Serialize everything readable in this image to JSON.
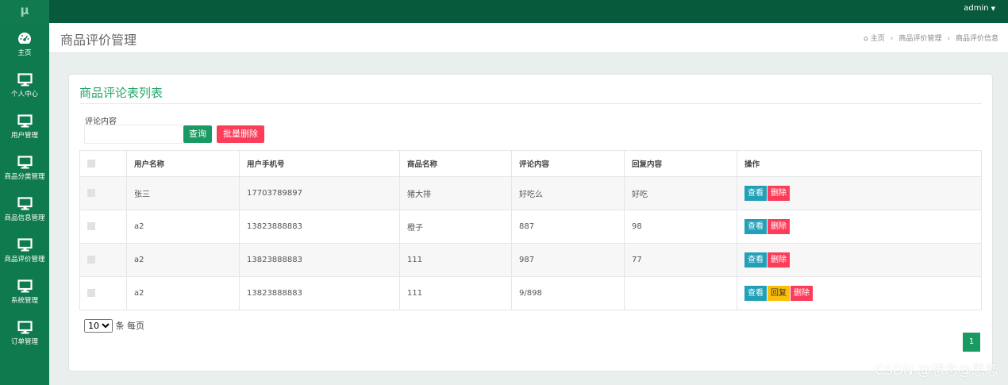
{
  "app": {
    "logo": "μ",
    "user": "admin"
  },
  "sidebar": {
    "items": [
      {
        "label": "主页",
        "icon": "dashboard-icon"
      },
      {
        "label": "个人中心",
        "icon": "monitor-icon"
      },
      {
        "label": "用户管理",
        "icon": "monitor-icon"
      },
      {
        "label": "商品分类管理",
        "icon": "monitor-icon"
      },
      {
        "label": "商品信息管理",
        "icon": "monitor-icon"
      },
      {
        "label": "商品评价管理",
        "icon": "monitor-icon"
      },
      {
        "label": "系统管理",
        "icon": "monitor-icon"
      },
      {
        "label": "订单管理",
        "icon": "monitor-icon"
      }
    ]
  },
  "header": {
    "title": "商品评价管理",
    "breadcrumb": [
      "主页",
      "商品评价管理",
      "商品评价信息"
    ]
  },
  "main": {
    "card_title": "商品评论表列表",
    "filter": {
      "label": "评论内容",
      "value": "",
      "search_label": "查询",
      "bulk_delete_label": "批量删除"
    },
    "table": {
      "columns": [
        "用户名称",
        "用户手机号",
        "商品名称",
        "评论内容",
        "回复内容",
        "操作"
      ],
      "rows": [
        {
          "user": "张三",
          "phone": "17703789897",
          "product": "猪大排",
          "comment": "好吃么",
          "reply": "好吃",
          "actions": [
            "查看",
            "删除"
          ]
        },
        {
          "user": "a2",
          "phone": "13823888883",
          "product": "橙子",
          "comment": "887",
          "reply": "98",
          "actions": [
            "查看",
            "删除"
          ]
        },
        {
          "user": "a2",
          "phone": "13823888883",
          "product": "111",
          "comment": "987",
          "reply": "77",
          "actions": [
            "查看",
            "删除"
          ]
        },
        {
          "user": "a2",
          "phone": "13823888883",
          "product": "111",
          "comment": "9/898",
          "reply": "",
          "actions": [
            "查看",
            "回复",
            "删除"
          ]
        }
      ]
    },
    "pagination": {
      "page_size": "10",
      "page_size_suffix": "条 每页",
      "current_page": "1"
    }
  },
  "watermark": "CSDN @想念@思恋",
  "colors": {
    "sidebar": "#0f7a4d",
    "topbar": "#085a3c",
    "primary": "#1a9a63",
    "danger": "#fc3d5a",
    "info": "#21a0b8",
    "warning": "#fbbf07"
  }
}
